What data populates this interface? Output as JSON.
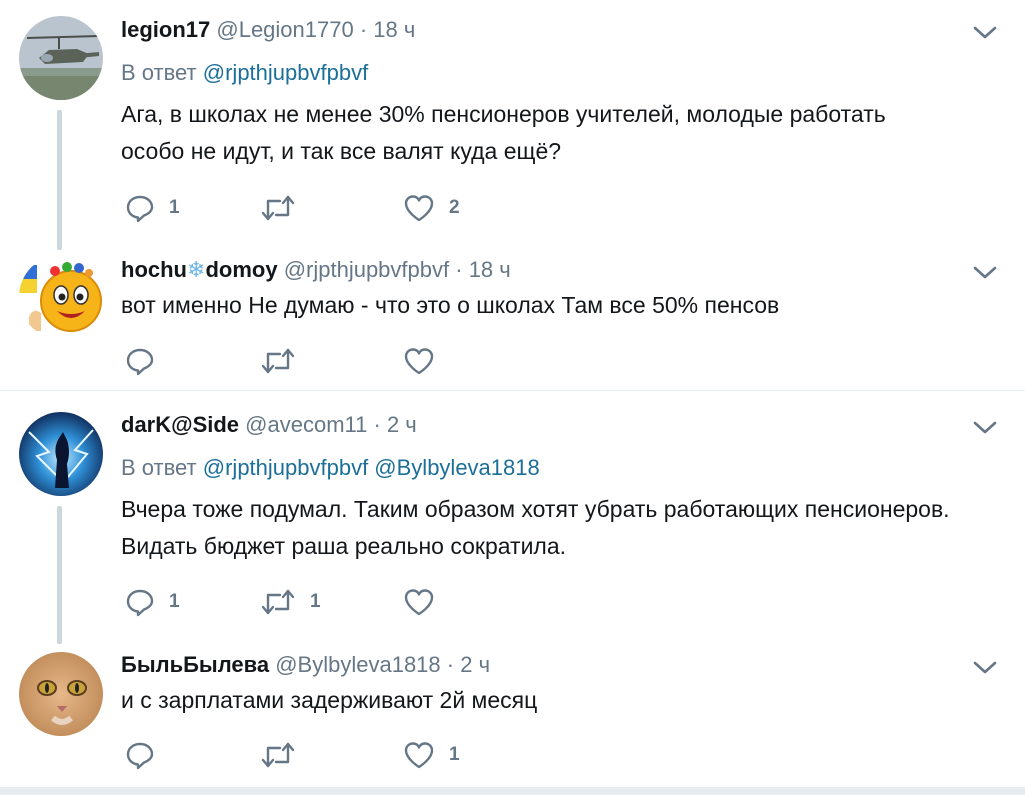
{
  "tweets": [
    {
      "name": "legion17",
      "handle": "@Legion1770",
      "dot": "·",
      "time": "18 ч",
      "reply_prefix": "В ответ",
      "reply_mentions": "@rjpthjupbvfpbvf",
      "text_line1": "Ага,  в школах не менее 30% пенсионеров учителей, молодые работать",
      "text_line2": "особо не идут, и так все валят куда ещё?",
      "reply_count": "1",
      "retweet_count": "",
      "like_count": "2"
    },
    {
      "name_part1": "hochu",
      "name_snow": "❄",
      "name_part2": "domoy",
      "handle": "@rjpthjupbvfpbvf",
      "dot": "·",
      "time": "18 ч",
      "text_line1": "вот именно Не думаю - что это о школах Там все 50% пенсов",
      "reply_count": "",
      "retweet_count": "",
      "like_count": ""
    },
    {
      "name": "darK@Side",
      "handle": "@avecom11",
      "dot": "·",
      "time": "2 ч",
      "reply_prefix": "В ответ",
      "reply_mentions": "@rjpthjupbvfpbvf @Bylbyleva1818",
      "text_line1": "Вчера тоже подумал. Таким образом хотят убрать работающих пенсионеров.",
      "text_line2": "Видать бюджет раша реально сократила.",
      "reply_count": "1",
      "retweet_count": "1",
      "like_count": ""
    },
    {
      "name": "БыльБылева",
      "handle": "@Bylbyleva1818",
      "dot": "·",
      "time": "2 ч",
      "text_line1": "и с зарплатами задерживают 2й месяц",
      "reply_count": "",
      "retweet_count": "",
      "like_count": "1"
    }
  ],
  "colors": {
    "text": "#14171a",
    "secondary": "#657786",
    "mention": "#1b6f99",
    "thread_line": "#ccd6dd",
    "separator": "#e6ecf0"
  },
  "icons": [
    "reply-icon",
    "retweet-icon",
    "like-icon",
    "caret-down-icon"
  ]
}
